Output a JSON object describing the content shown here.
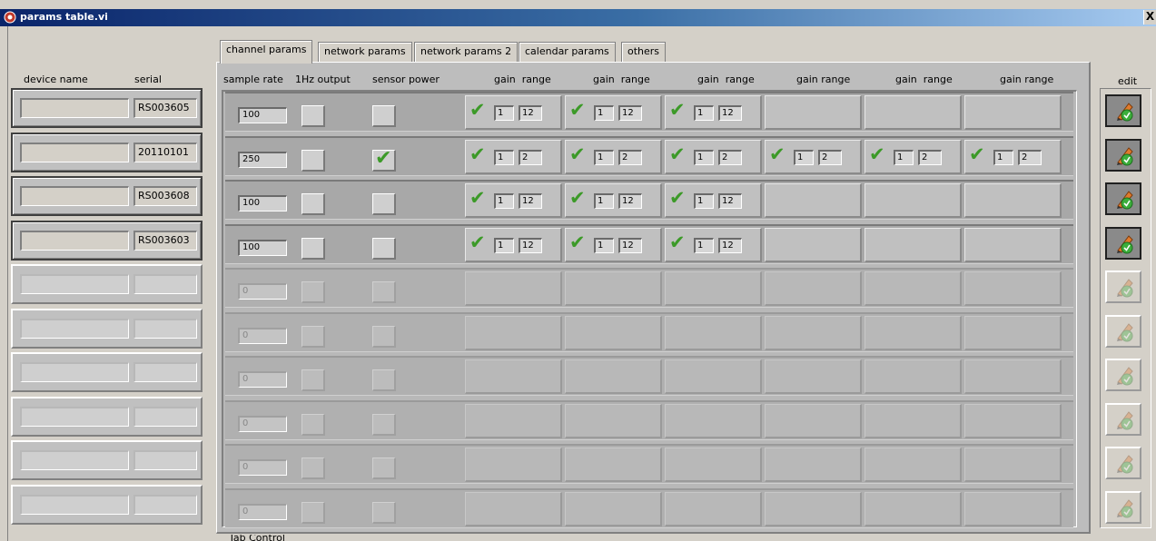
{
  "window": {
    "title": "params table.vi",
    "close_glyph": "X"
  },
  "left": {
    "header_device": "device name",
    "header_serial": "serial"
  },
  "devices": [
    {
      "name": "",
      "serial": "RS003605",
      "active": true
    },
    {
      "name": "",
      "serial": "20110101",
      "active": true
    },
    {
      "name": "",
      "serial": "RS003608",
      "active": true
    },
    {
      "name": "",
      "serial": "RS003603",
      "active": true
    },
    {
      "name": "",
      "serial": "",
      "active": false
    },
    {
      "name": "",
      "serial": "",
      "active": false
    },
    {
      "name": "",
      "serial": "",
      "active": false
    },
    {
      "name": "",
      "serial": "",
      "active": false
    },
    {
      "name": "",
      "serial": "",
      "active": false
    },
    {
      "name": "",
      "serial": "",
      "active": false
    }
  ],
  "tabs": [
    {
      "label": "channel params",
      "selected": true
    },
    {
      "label": "network params",
      "selected": false
    },
    {
      "label": "network params 2",
      "selected": false
    },
    {
      "label": "calendar params",
      "selected": false
    },
    {
      "label": "others",
      "selected": false
    }
  ],
  "columns": {
    "sample_rate": "sample rate",
    "output_1hz": "1Hz output",
    "sensor_power": "sensor power",
    "gain_headers": [
      "gain  range",
      "gain  range",
      "gain  range",
      "gain range",
      "gain  range",
      "gain range"
    ]
  },
  "channel_rows": [
    {
      "sample_rate": "100",
      "output_1hz": false,
      "sensor_power": false,
      "active": true,
      "gains": [
        {
          "on": true,
          "gain": "1",
          "range": "12"
        },
        {
          "on": true,
          "gain": "1",
          "range": "12"
        },
        {
          "on": true,
          "gain": "1",
          "range": "12"
        },
        null,
        null,
        null
      ]
    },
    {
      "sample_rate": "250",
      "output_1hz": false,
      "sensor_power": true,
      "active": true,
      "gains": [
        {
          "on": true,
          "gain": "1",
          "range": "2"
        },
        {
          "on": true,
          "gain": "1",
          "range": "2"
        },
        {
          "on": true,
          "gain": "1",
          "range": "2"
        },
        {
          "on": true,
          "gain": "1",
          "range": "2"
        },
        {
          "on": true,
          "gain": "1",
          "range": "2"
        },
        {
          "on": true,
          "gain": "1",
          "range": "2"
        }
      ]
    },
    {
      "sample_rate": "100",
      "output_1hz": false,
      "sensor_power": false,
      "active": true,
      "gains": [
        {
          "on": true,
          "gain": "1",
          "range": "12"
        },
        {
          "on": true,
          "gain": "1",
          "range": "12"
        },
        {
          "on": true,
          "gain": "1",
          "range": "12"
        },
        null,
        null,
        null
      ]
    },
    {
      "sample_rate": "100",
      "output_1hz": false,
      "sensor_power": false,
      "active": true,
      "gains": [
        {
          "on": true,
          "gain": "1",
          "range": "12"
        },
        {
          "on": true,
          "gain": "1",
          "range": "12"
        },
        {
          "on": true,
          "gain": "1",
          "range": "12"
        },
        null,
        null,
        null
      ]
    },
    {
      "sample_rate": "0",
      "output_1hz": false,
      "sensor_power": false,
      "active": false,
      "gains": [
        null,
        null,
        null,
        null,
        null,
        null
      ]
    },
    {
      "sample_rate": "0",
      "output_1hz": false,
      "sensor_power": false,
      "active": false,
      "gains": [
        null,
        null,
        null,
        null,
        null,
        null
      ]
    },
    {
      "sample_rate": "0",
      "output_1hz": false,
      "sensor_power": false,
      "active": false,
      "gains": [
        null,
        null,
        null,
        null,
        null,
        null
      ]
    },
    {
      "sample_rate": "0",
      "output_1hz": false,
      "sensor_power": false,
      "active": false,
      "gains": [
        null,
        null,
        null,
        null,
        null,
        null
      ]
    },
    {
      "sample_rate": "0",
      "output_1hz": false,
      "sensor_power": false,
      "active": false,
      "gains": [
        null,
        null,
        null,
        null,
        null,
        null
      ]
    },
    {
      "sample_rate": "0",
      "output_1hz": false,
      "sensor_power": false,
      "active": false,
      "gains": [
        null,
        null,
        null,
        null,
        null,
        null
      ]
    }
  ],
  "edit": {
    "header": "edit"
  },
  "footer": {
    "caption": "Tab Control"
  },
  "colors": {
    "check_green": "#3c9a28",
    "title_blue": "#0a246a"
  }
}
